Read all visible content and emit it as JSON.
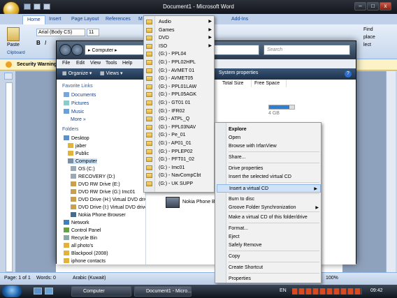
{
  "word": {
    "title": "Document1 - Microsoft Word",
    "tabs": [
      "Home",
      "Insert",
      "Page Layout",
      "References",
      "M"
    ],
    "addins_tab": "Add-Ins",
    "font_name": "Arial (Body CS)",
    "font_size": "11",
    "paste_label": "Paste",
    "clipboard_label": "Clipboard",
    "find_label": "Find",
    "replace_label": "place",
    "select_label": "lect",
    "security_warning": "Security Warning",
    "status": {
      "page": "Page: 1 of 1",
      "words": "Words: 0",
      "language": "Arabic (Kuwait)",
      "zoom": "100%"
    }
  },
  "explorer": {
    "address": "Computer",
    "search_placeholder": "Search",
    "menu": [
      "File",
      "Edit",
      "View",
      "Tools",
      "Help"
    ],
    "toolbar": {
      "organize": "Organize",
      "views": "Views",
      "system_properties": "System properties"
    },
    "columns": [
      "Total Size",
      "Free Space"
    ],
    "favorite_links_header": "Favorite Links",
    "favorites": [
      "Documents",
      "Pictures",
      "Music",
      "More »"
    ],
    "folders_header": "Folders",
    "folders": [
      "Desktop",
      "jaber",
      "Public",
      "Computer",
      "OS (C:)",
      "RECOVERY (D:)",
      "DVD RW Drive (E:)",
      "DVD RW Drive (G:) Imc01",
      "DVD Drive (H:) Virtual DVD drive",
      "DVD Drive (I:) Virtual DVD drive",
      "Nokia Phone Browser",
      "Network",
      "Control Panel",
      "Recycle Bin",
      "all photo's",
      "Blackpool (2008)",
      "iphone contacts"
    ],
    "main_item": "Nokia Phone Br",
    "size_fragment": "4 GB"
  },
  "submenu": {
    "items": [
      {
        "label": "Audio",
        "arrow": true
      },
      {
        "label": "Games",
        "arrow": true
      },
      {
        "label": "DVD",
        "arrow": true
      },
      {
        "label": "ISO",
        "arrow": true
      },
      {
        "label": "(G:) - PPL04",
        "arrow": false
      },
      {
        "label": "(G:) - PPL02HPL",
        "arrow": false
      },
      {
        "label": "(G:) - AVMET 01",
        "arrow": false
      },
      {
        "label": "(G:) - AVMET05",
        "arrow": false
      },
      {
        "label": "(G:) - PPL01LAW",
        "arrow": false
      },
      {
        "label": "(G:) - PPL05AGK",
        "arrow": false
      },
      {
        "label": "(G:) - GT01 01",
        "arrow": false
      },
      {
        "label": "(G:) - IFR02",
        "arrow": false
      },
      {
        "label": "(G:) - ATPL_Q",
        "arrow": false
      },
      {
        "label": "(G:) - PPL03NAV",
        "arrow": false
      },
      {
        "label": "(G:) - Pe_01",
        "arrow": false
      },
      {
        "label": "(G:) - AP01_01",
        "arrow": false
      },
      {
        "label": "(G:) - PPLEP02",
        "arrow": false
      },
      {
        "label": "(G:) - PFT01_02",
        "arrow": false
      },
      {
        "label": "(G:) - Imc01",
        "arrow": false
      },
      {
        "label": "(G:) - NavCompCbt",
        "arrow": false
      },
      {
        "label": "(G:) - UK SUPP",
        "arrow": false
      }
    ]
  },
  "context_menu": {
    "items": [
      {
        "label": "Explore",
        "bold": true,
        "arrow": false,
        "highlight": false
      },
      {
        "label": "Open",
        "bold": false,
        "arrow": false,
        "highlight": false
      },
      {
        "label": "Browse with IrfanView",
        "bold": false,
        "arrow": false,
        "highlight": false
      },
      {
        "label": "Share...",
        "bold": false,
        "arrow": false,
        "highlight": false
      },
      {
        "label": "Drive properties",
        "bold": false,
        "arrow": false,
        "highlight": false
      },
      {
        "label": "Insert the selected virtual CD",
        "bold": false,
        "arrow": false,
        "highlight": false
      },
      {
        "label": "Insert a virtual CD",
        "bold": false,
        "arrow": true,
        "highlight": true
      },
      {
        "label": "Burn to disc",
        "bold": false,
        "arrow": false,
        "highlight": false
      },
      {
        "label": "Groove Folder Synchronization",
        "bold": false,
        "arrow": true,
        "highlight": false
      },
      {
        "label": "Make a virtual CD of this folder/drive",
        "bold": false,
        "arrow": false,
        "highlight": false
      },
      {
        "label": "Format...",
        "bold": false,
        "arrow": false,
        "highlight": false
      },
      {
        "label": "Eject",
        "bold": false,
        "arrow": false,
        "highlight": false
      },
      {
        "label": "Safely Remove",
        "bold": false,
        "arrow": false,
        "highlight": false
      },
      {
        "label": "Copy",
        "bold": false,
        "arrow": false,
        "highlight": false
      },
      {
        "label": "Create Shortcut",
        "bold": false,
        "arrow": false,
        "highlight": false
      },
      {
        "label": "Properties",
        "bold": false,
        "arrow": false,
        "highlight": false
      }
    ]
  },
  "taskbar": {
    "buttons": [
      "Computer",
      "Document1 - Micro..."
    ],
    "language": "EN",
    "clock": "09:42"
  }
}
